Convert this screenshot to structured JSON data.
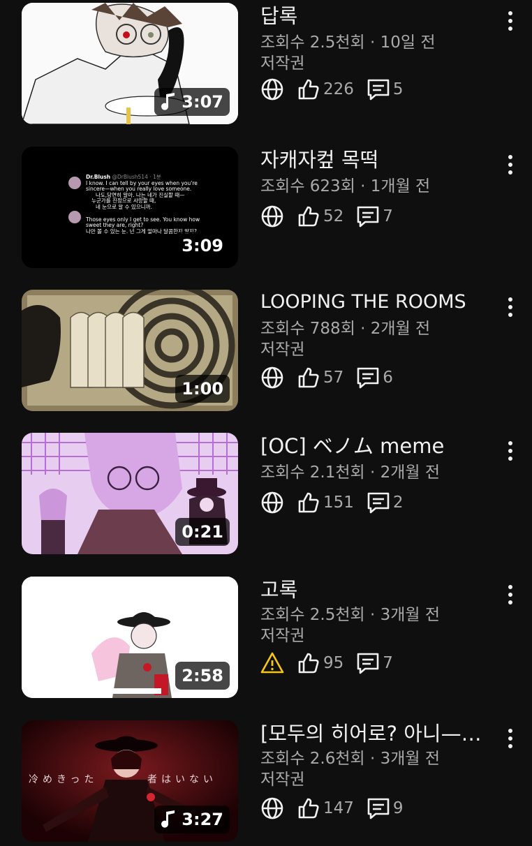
{
  "videos": [
    {
      "title": "답록",
      "meta_line": "조회수 2.5천회 · 10일 전",
      "license": "저작권",
      "duration": "3:07",
      "has_music_icon": true,
      "visibility_icon": "globe-icon",
      "likes": "226",
      "comments": "5",
      "accent": "#ffffff"
    },
    {
      "title": "자캐자컾 목떡",
      "meta_line": "조회수 623회 · 1개월 전",
      "license": "",
      "duration": "3:09",
      "has_music_icon": false,
      "visibility_icon": "globe-icon",
      "likes": "52",
      "comments": "7",
      "accent": "#000000",
      "thumb_text": {
        "name": "Dr.Blush",
        "handle": "@DrBlush514 · 1분",
        "line1": "I know. I can tell by your eyes when you're",
        "line2": "sincere—when you really love someone.",
        "ko1": "나도,당연히 알아. 나는 네가 진실할 때—",
        "ko2": "누군가를 진정으로 사랑할 때,",
        "ko3": "네 눈으로 알 수 있으니까.",
        "line3": "Those eyes only I get to see. You know how",
        "line4": "sweet they are, right?",
        "ko4": "나만 볼 수 있는 눈. 넌 그게 얼마나 달콤한지 알지?"
      }
    },
    {
      "title": "LOOPING THE ROOMS",
      "meta_line": "조회수 788회 · 2개월 전",
      "license": "저작권",
      "duration": "1:00",
      "has_music_icon": false,
      "visibility_icon": "globe-icon",
      "likes": "57",
      "comments": "6",
      "accent": "#8a7d5c"
    },
    {
      "title": "[OC] ベノム meme",
      "meta_line": "조회수 2.1천회 · 2개월 전",
      "license": "",
      "duration": "0:21",
      "has_music_icon": false,
      "visibility_icon": "globe-icon",
      "likes": "151",
      "comments": "2",
      "accent": "#b06fd0"
    },
    {
      "title": "고록",
      "meta_line": "조회수 2.5천회 · 3개월 전",
      "license": "저작권",
      "duration": "2:58",
      "has_music_icon": false,
      "visibility_icon": "warning-icon",
      "likes": "95",
      "comments": "7",
      "accent": "#ffffff"
    },
    {
      "title": "[모두의 히어로? 아니—…",
      "meta_line": "조회수 2.6천회 · 3개월 전",
      "license": "저작권",
      "duration": "3:27",
      "has_music_icon": true,
      "visibility_icon": "globe-icon",
      "likes": "147",
      "comments": "9",
      "accent": "#5a0e12",
      "thumb_text": {
        "left": "冷めきった",
        "right": "者はいない"
      }
    }
  ]
}
